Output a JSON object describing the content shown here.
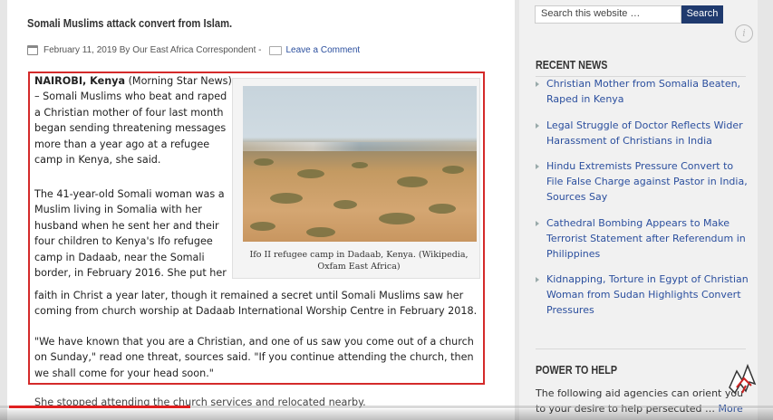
{
  "post": {
    "title": "Somali Muslims attack convert from Islam.",
    "date_byline": "February 11, 2019 By Our East Africa Correspondent -",
    "comment_link": "Leave a Comment",
    "lead_bold": "NAIROBI, Kenya",
    "lead_rest": " (Morning Star News) – Somali Muslims who beat and raped a Christian mother of four last month began sending threatening messages more than a year ago at a refugee camp in Kenya, she said.",
    "para2": "The 41-year-old Somali woman was a Muslim living in Somalia with her husband when he sent her and their four children to Kenya's Ifo refugee camp in Dadaab, near the Somali border, in February 2016. She put her",
    "para2_cont": "faith in Christ a year later, though it remained a secret until Somali Muslims saw her coming from church worship at Dadaab International Worship Centre in February 2018.",
    "para3": "\"We have known that you are a Christian, and one of us saw you come out of a church on Sunday,\" read one threat, sources said. \"If you continue attending the church, then we shall come for your head soon.\"",
    "para4": "She stopped attending the church services and relocated nearby.",
    "image_caption": "Ifo II refugee camp in Dadaab, Kenya. (Wikipedia, Oxfam East Africa)"
  },
  "sidebar": {
    "search_placeholder": "Search this website …",
    "search_button": "Search",
    "recent_news_heading": "RECENT NEWS",
    "recent_news": [
      "Christian Mother from Somalia Beaten, Raped in Kenya",
      "Legal Struggle of Doctor Reflects Wider Harassment of Christians in India",
      "Hindu Extremists Pressure Convert to File False Charge against Pastor in India, Sources Say",
      "Cathedral Bombing Appears to Make Terrorist Statement after Referendum in Philippines",
      "Kidnapping, Torture in Egypt of Christian Woman from Sudan Highlights Convert Pressures"
    ],
    "power_heading": "POWER TO HELP",
    "power_text": "The following aid agencies can orient you to your desire to help persecuted …",
    "more_link": "More"
  },
  "video": {
    "info_glyph": "i",
    "progress": 0.24
  },
  "colors": {
    "highlight_border": "#d42a2a",
    "link": "#2b4f9e",
    "search_button": "#1f3a6e",
    "progress": "#e02020"
  }
}
